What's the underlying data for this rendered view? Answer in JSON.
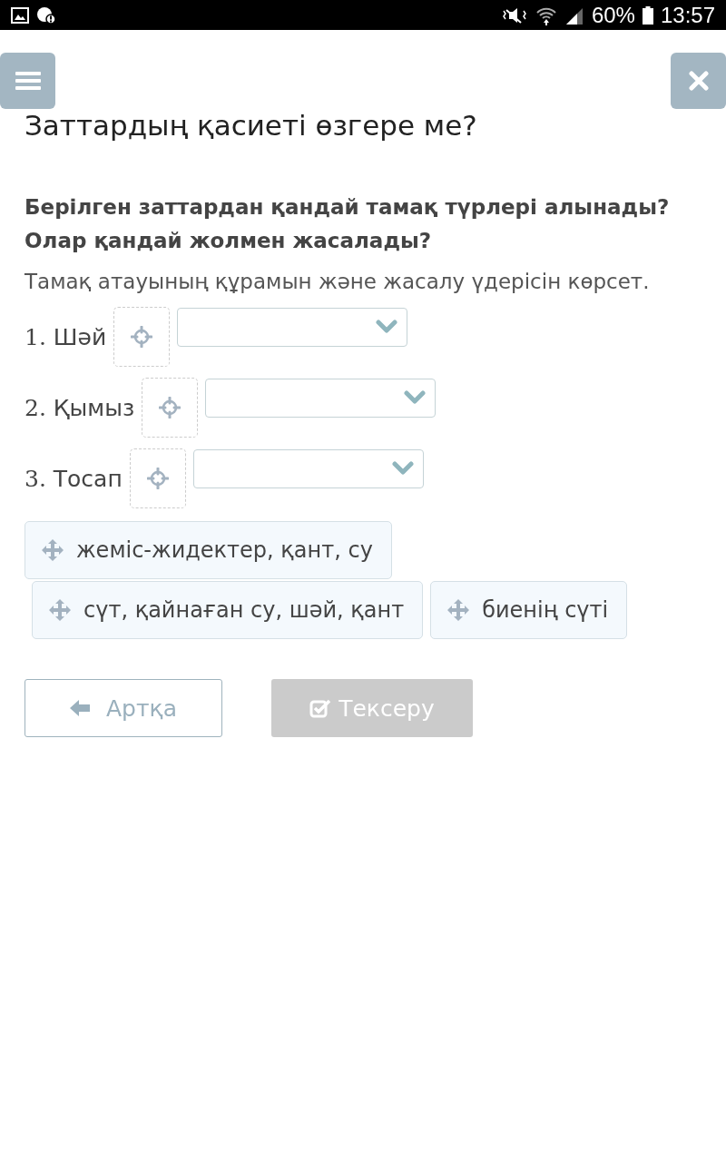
{
  "status_bar": {
    "battery": "60%",
    "time": "13:57"
  },
  "title": "Заттардың қасиеті өзгере ме?",
  "question": [
    "Берілген заттардан қандай тамақ түрлері алынады?",
    "Олар қандай жолмен жасалады?"
  ],
  "instruction": "Тамақ атауының құрамын және жасалу үдерісін көрсет.",
  "items": [
    {
      "number": "1.",
      "label": "Шәй"
    },
    {
      "number": "2.",
      "label": "Қымыз"
    },
    {
      "number": "3.",
      "label": "Тосап"
    }
  ],
  "answers": [
    "жеміс-жидектер, қант, су",
    "сүт, қайнаған су, шәй, қант",
    "биенің сүті"
  ],
  "buttons": [
    {
      "label": "Артқа",
      "kind": "back",
      "disabled": false
    },
    {
      "label": "Тексеру",
      "kind": "check",
      "disabled": true
    }
  ]
}
